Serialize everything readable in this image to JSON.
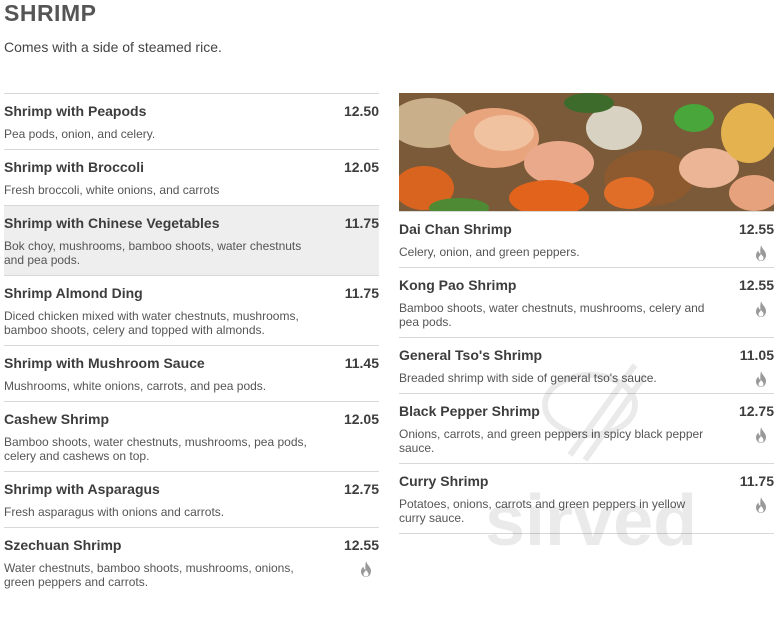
{
  "header": {
    "title": "SHRIMP",
    "subtitle": "Comes with a side of steamed rice."
  },
  "left_items": [
    {
      "name": "Shrimp with Peapods",
      "price": "12.50",
      "desc": "Pea pods, onion, and celery.",
      "spicy": false
    },
    {
      "name": "Shrimp with Broccoli",
      "price": "12.05",
      "desc": "Fresh broccoli, white onions, and carrots",
      "spicy": false
    },
    {
      "name": "Shrimp with Chinese Vegetables",
      "price": "11.75",
      "desc": "Bok choy, mushrooms, bamboo shoots, water chestnuts and pea pods.",
      "spicy": false
    },
    {
      "name": "Shrimp Almond Ding",
      "price": "11.75",
      "desc": "Diced chicken mixed with water chestnuts, mushrooms, bamboo shoots, celery and topped with almonds.",
      "spicy": false
    },
    {
      "name": "Shrimp with Mushroom Sauce",
      "price": "11.45",
      "desc": "Mushrooms, white onions, carrots, and pea pods.",
      "spicy": false
    },
    {
      "name": "Cashew Shrimp",
      "price": "12.05",
      "desc": "Bamboo shoots, water chestnuts, mushrooms, pea pods, celery and cashews on top.",
      "spicy": false
    },
    {
      "name": "Shrimp with Asparagus",
      "price": "12.75",
      "desc": "Fresh asparagus with onions and carrots.",
      "spicy": false
    },
    {
      "name": "Szechuan Shrimp",
      "price": "12.55",
      "desc": "Water chestnuts, bamboo shoots, mushrooms, onions, green peppers and carrots.",
      "spicy": true
    }
  ],
  "right_items": [
    {
      "name": "Dai Chan Shrimp",
      "price": "12.55",
      "desc": "Celery, onion, and green peppers.",
      "spicy": true
    },
    {
      "name": "Kong Pao Shrimp",
      "price": "12.55",
      "desc": "Bamboo shoots, water chestnuts, mushrooms, celery and pea pods.",
      "spicy": true
    },
    {
      "name": "General Tso's Shrimp",
      "price": "11.05",
      "desc": "Breaded shrimp with side of general tso's sauce.",
      "spicy": true
    },
    {
      "name": "Black Pepper Shrimp",
      "price": "12.75",
      "desc": "Onions, carrots, and green peppers in spicy black pepper sauce.",
      "spicy": true
    },
    {
      "name": "Curry Shrimp",
      "price": "11.75",
      "desc": "Potatoes, onions, carrots and green peppers in yellow curry sauce.",
      "spicy": true
    }
  ],
  "highlighted_item_index": 2,
  "icons": {
    "spicy": "flame-icon",
    "photo": "shrimp-dish-photo",
    "watermark": "sirved-watermark-logo"
  },
  "colors": {
    "text": "#3d3d3d",
    "divider": "#d8d8d8",
    "highlight": "#eeeeee",
    "spicy_icon": "#999999"
  },
  "watermark_text": "sirved"
}
